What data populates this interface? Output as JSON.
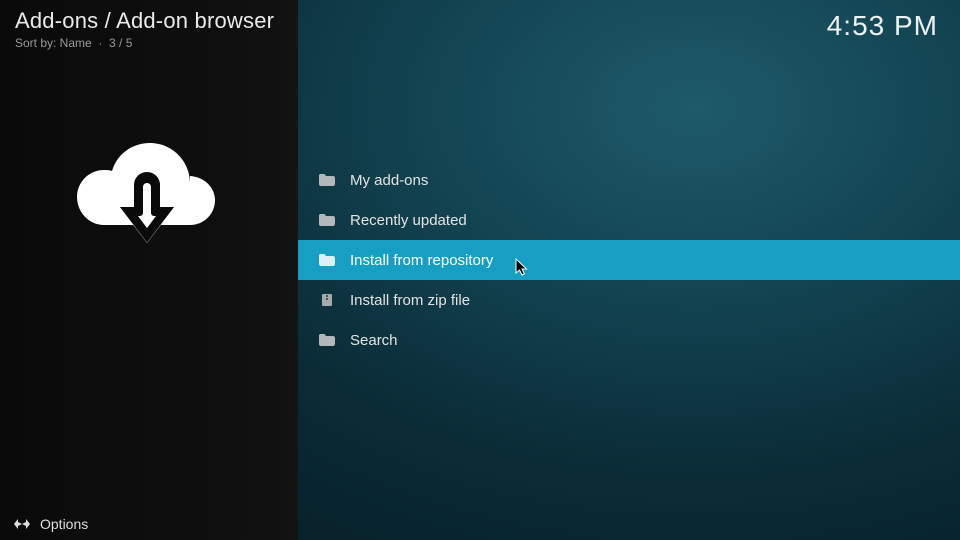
{
  "header": {
    "breadcrumb": "Add-ons / Add-on browser",
    "sort_label": "Sort by: Name",
    "dot": "·",
    "position": "3 / 5"
  },
  "clock": "4:53 PM",
  "list": {
    "items": [
      {
        "label": "My add-ons",
        "icon": "folder",
        "selected": false
      },
      {
        "label": "Recently updated",
        "icon": "folder",
        "selected": false
      },
      {
        "label": "Install from repository",
        "icon": "folder",
        "selected": true
      },
      {
        "label": "Install from zip file",
        "icon": "zip",
        "selected": false
      },
      {
        "label": "Search",
        "icon": "folder",
        "selected": false
      }
    ]
  },
  "options": {
    "label": "Options"
  }
}
